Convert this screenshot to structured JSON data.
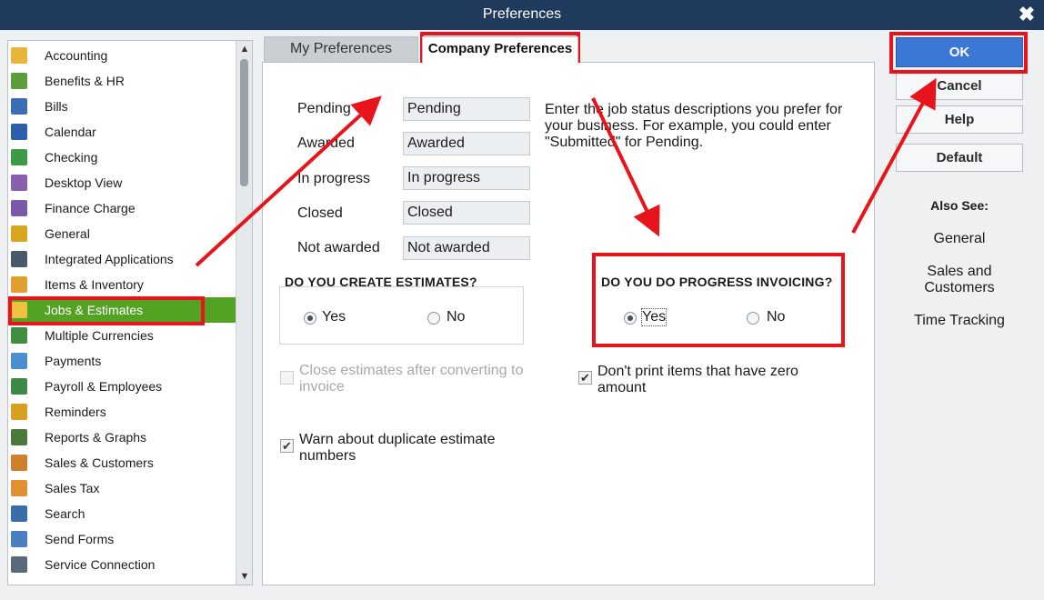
{
  "window": {
    "title": "Preferences",
    "close_glyph": "✖"
  },
  "sidebar": {
    "items": [
      {
        "label": "Accounting",
        "icon": "accounting-icon",
        "color": "#e8b53a"
      },
      {
        "label": "Benefits & HR",
        "icon": "benefits-icon",
        "color": "#5c9e3c"
      },
      {
        "label": "Bills",
        "icon": "bills-icon",
        "color": "#3a6fb5"
      },
      {
        "label": "Calendar",
        "icon": "calendar-icon",
        "color": "#2c5fa8"
      },
      {
        "label": "Checking",
        "icon": "checking-icon",
        "color": "#3d9b48"
      },
      {
        "label": "Desktop View",
        "icon": "desktop-view-icon",
        "color": "#8a5fb0"
      },
      {
        "label": "Finance Charge",
        "icon": "finance-charge-icon",
        "color": "#7d5aa8"
      },
      {
        "label": "General",
        "icon": "general-icon",
        "color": "#d9a520"
      },
      {
        "label": "Integrated Applications",
        "icon": "integrated-apps-icon",
        "color": "#4a5a6a"
      },
      {
        "label": "Items & Inventory",
        "icon": "items-inventory-icon",
        "color": "#e0a030"
      },
      {
        "label": "Jobs & Estimates",
        "icon": "jobs-estimates-icon",
        "color": "#f0c040",
        "selected": true
      },
      {
        "label": "Multiple Currencies",
        "icon": "multiple-currencies-icon",
        "color": "#3f8f3f"
      },
      {
        "label": "Payments",
        "icon": "payments-icon",
        "color": "#4a8fd0"
      },
      {
        "label": "Payroll & Employees",
        "icon": "payroll-icon",
        "color": "#3d8a46"
      },
      {
        "label": "Reminders",
        "icon": "reminders-icon",
        "color": "#d8a020"
      },
      {
        "label": "Reports & Graphs",
        "icon": "reports-graphs-icon",
        "color": "#4a7a3a"
      },
      {
        "label": "Sales & Customers",
        "icon": "sales-customers-icon",
        "color": "#d0802a"
      },
      {
        "label": "Sales Tax",
        "icon": "sales-tax-icon",
        "color": "#e09030"
      },
      {
        "label": "Search",
        "icon": "search-icon",
        "color": "#3a6ea8"
      },
      {
        "label": "Send Forms",
        "icon": "send-forms-icon",
        "color": "#4a7fc0"
      },
      {
        "label": "Service Connection",
        "icon": "service-connection-icon",
        "color": "#5a6a7a"
      }
    ]
  },
  "tabs": {
    "my": "My Preferences",
    "company": "Company Preferences"
  },
  "job_status": {
    "rows": [
      {
        "label": "Pending",
        "value": "Pending"
      },
      {
        "label": "Awarded",
        "value": "Awarded"
      },
      {
        "label": "In progress",
        "value": "In progress"
      },
      {
        "label": "Closed",
        "value": "Closed"
      },
      {
        "label": "Not awarded",
        "value": "Not awarded"
      }
    ],
    "description": "Enter the job status descriptions you prefer for your business.  For example, you could enter \"Submitted\" for Pending."
  },
  "estimates": {
    "title": "DO YOU CREATE ESTIMATES?",
    "yes": "Yes",
    "no": "No",
    "selected": "Yes"
  },
  "progress": {
    "title": "DO YOU DO PROGRESS INVOICING?",
    "yes": "Yes",
    "no": "No",
    "selected": "Yes"
  },
  "options": {
    "close_estimates": "Close estimates after converting to invoice",
    "dont_print_zero": "Don't print items that have zero amount",
    "warn_duplicate": "Warn about duplicate estimate numbers"
  },
  "buttons": {
    "ok": "OK",
    "cancel": "Cancel",
    "help": "Help",
    "default": "Default"
  },
  "also_see": {
    "title": "Also See:",
    "links": [
      "General",
      "Sales and Customers",
      "Time Tracking"
    ]
  },
  "colors": {
    "titlebar": "#1f3a5c",
    "selected": "#54a223",
    "ok": "#3b78d6",
    "highlight": "#e8141b"
  }
}
